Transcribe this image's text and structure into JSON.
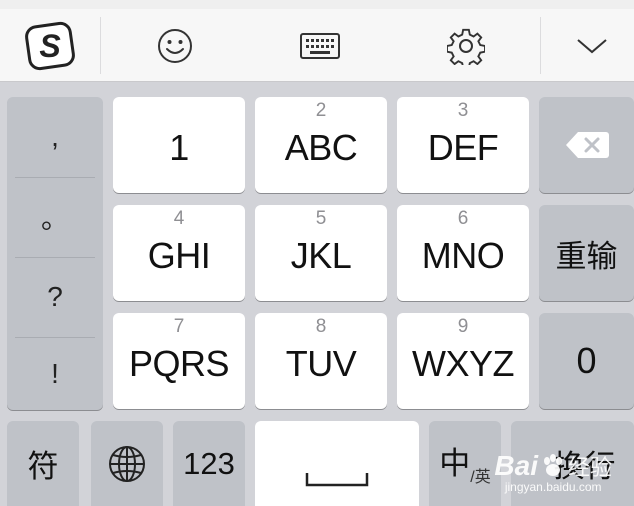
{
  "toolbar": {
    "icons": [
      "sogou-logo-icon",
      "emoji-icon",
      "keyboard-icon",
      "settings-icon",
      "chevron-down-icon"
    ]
  },
  "punctuation": [
    ",",
    "。",
    "?",
    "!"
  ],
  "keys": {
    "k1": {
      "digit": "",
      "letters": "1"
    },
    "k2": {
      "digit": "2",
      "letters": "ABC"
    },
    "k3": {
      "digit": "3",
      "letters": "DEF"
    },
    "k4": {
      "digit": "4",
      "letters": "GHI"
    },
    "k5": {
      "digit": "5",
      "letters": "JKL"
    },
    "k6": {
      "digit": "6",
      "letters": "MNO"
    },
    "k7": {
      "digit": "7",
      "letters": "PQRS"
    },
    "k8": {
      "digit": "8",
      "letters": "TUV"
    },
    "k9": {
      "digit": "9",
      "letters": "WXYZ"
    }
  },
  "side_keys": {
    "reinput": "重输",
    "zero": "0"
  },
  "bottom_row": {
    "symbols": "符",
    "numbers": "123",
    "lang_main": "中",
    "lang_sub": "/英",
    "enter": "换行"
  },
  "watermark": {
    "brand": "Bai",
    "brand2": "经验",
    "url": "jingyan.baidu.com"
  },
  "colors": {
    "key_white": "#ffffff",
    "key_gray": "#bfc2c8",
    "background": "#d2d3d8",
    "toolbar": "#f7f7f7"
  }
}
